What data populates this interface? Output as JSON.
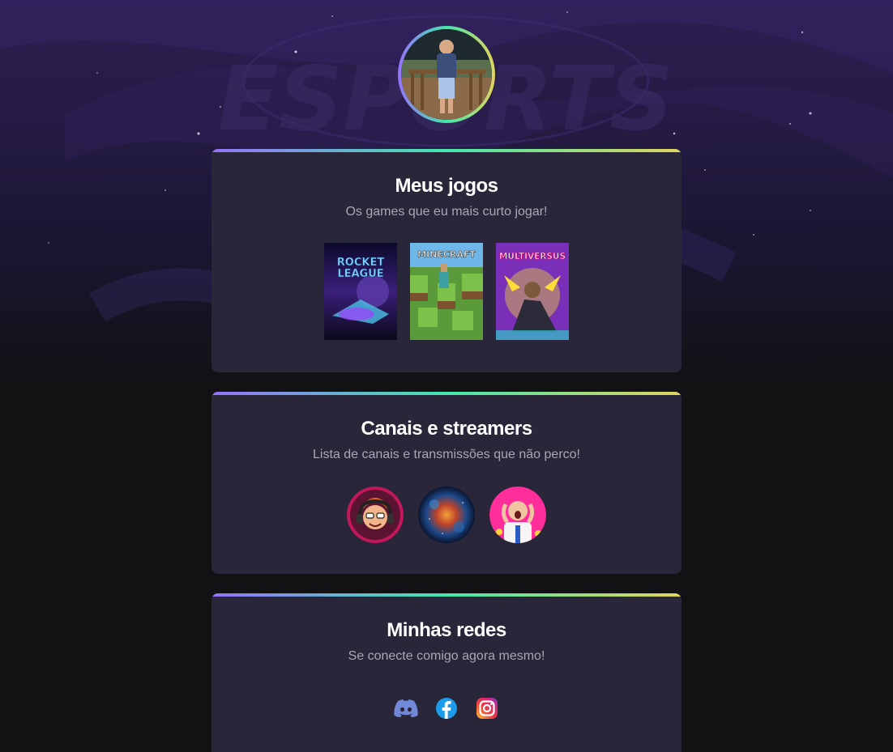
{
  "background": {
    "watermark_text": "ESPORTS"
  },
  "profile": {
    "avatar_icon": "profile-photo"
  },
  "cards": {
    "games": {
      "title": "Meus jogos",
      "subtitle": "Os games que eu mais curto jogar!",
      "items": [
        {
          "name": "Rocket League",
          "cover_line1": "ROCKET",
          "cover_line2": "LEAGUE"
        },
        {
          "name": "Minecraft",
          "cover_line1": "MINECRAFT"
        },
        {
          "name": "MultiVersus",
          "cover_line1": "MULTIVERSUS"
        }
      ]
    },
    "channels": {
      "title": "Canais e streamers",
      "subtitle": "Lista de canais e transmissões que não perco!",
      "items": [
        {
          "icon": "cartoon-gamer-avatar"
        },
        {
          "icon": "space-nebula-avatar"
        },
        {
          "icon": "surprised-person-avatar"
        }
      ]
    },
    "socials": {
      "title": "Minhas redes",
      "subtitle": "Se conecte comigo agora mesmo!",
      "items": [
        {
          "icon": "discord-icon",
          "color": "#5865f2"
        },
        {
          "icon": "facebook-icon",
          "color": "#1877f2"
        },
        {
          "icon": "instagram-icon",
          "color": "#e1306c"
        }
      ]
    }
  },
  "colors": {
    "accent_gradient": [
      "#9572fc",
      "#43e7ad",
      "#e2d45c"
    ],
    "card_bg": "#29263a",
    "page_bg": "#121214"
  }
}
